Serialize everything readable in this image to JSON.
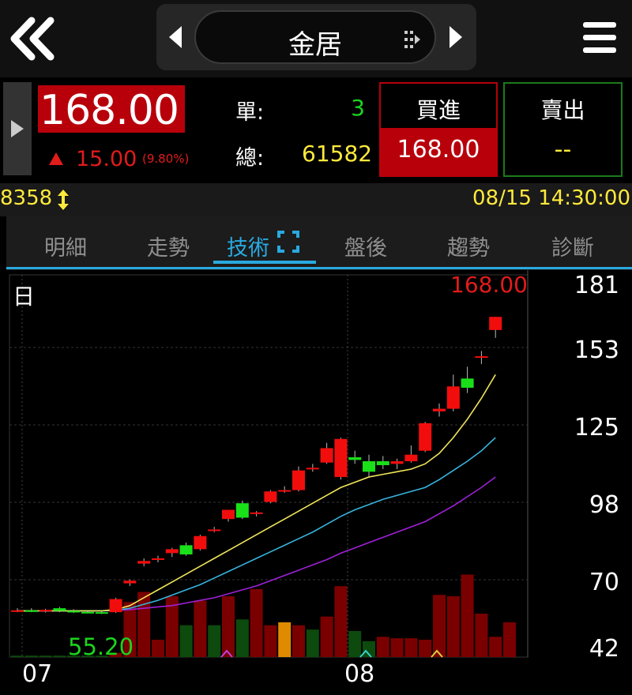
{
  "header": {
    "title": "金居",
    "icons": [
      "double-chevron-left-icon",
      "triangle-left-icon",
      "triangle-right-icon",
      "drag-handle-icon",
      "hamburger-menu-icon"
    ]
  },
  "quote": {
    "price": "168.00",
    "change": "15.00",
    "change_pct": "(9.80%)",
    "single_label": "單:",
    "single_value": "3",
    "total_label": "總:",
    "total_value": "61582",
    "buy_label": "買進",
    "buy_price": "168.00",
    "sell_label": "賣出",
    "sell_price": "--",
    "colors": {
      "up": "#e21b1b",
      "down": "#1cd51c",
      "accent": "#29a9e0",
      "highlight": "#ffea3c"
    }
  },
  "info": {
    "volume": "8358",
    "datetime": "08/15 14:30:00"
  },
  "tabs": [
    {
      "label": "明細",
      "active": false
    },
    {
      "label": "走勢",
      "active": false
    },
    {
      "label": "技術",
      "active": true
    },
    {
      "label": "盤後",
      "active": false
    },
    {
      "label": "趨勢",
      "active": false
    },
    {
      "label": "診斷",
      "active": false
    }
  ],
  "chart": {
    "period_label": "日",
    "last_price": "168.00",
    "min_label": "55.20",
    "y_ticks": [
      "181",
      "153",
      "125",
      "98",
      "70",
      "42"
    ],
    "x_ticks": [
      "07",
      "08"
    ]
  },
  "chart_data": {
    "type": "candlestick",
    "ylim": [
      42,
      181
    ],
    "x_ticks": [
      "07",
      "08"
    ],
    "candles": [
      {
        "o": 56.0,
        "h": 57.0,
        "l": 55.5,
        "c": 56.2
      },
      {
        "o": 56.2,
        "h": 57.0,
        "l": 55.5,
        "c": 56.0
      },
      {
        "o": 56.0,
        "h": 56.8,
        "l": 55.4,
        "c": 56.4
      },
      {
        "o": 57.0,
        "h": 57.5,
        "l": 55.5,
        "c": 56.0
      },
      {
        "o": 56.0,
        "h": 56.6,
        "l": 55.2,
        "c": 55.6
      },
      {
        "o": 55.6,
        "h": 56.0,
        "l": 55.2,
        "c": 55.5
      },
      {
        "o": 55.5,
        "h": 56.0,
        "l": 54.8,
        "c": 55.2
      },
      {
        "o": 55.5,
        "h": 61.0,
        "l": 55.2,
        "c": 60.5
      },
      {
        "o": 66.5,
        "h": 68.0,
        "l": 65.5,
        "c": 67.5
      },
      {
        "o": 74.0,
        "h": 76.0,
        "l": 73.0,
        "c": 75.0
      },
      {
        "o": 76.0,
        "h": 77.0,
        "l": 74.5,
        "c": 76.0
      },
      {
        "o": 78.0,
        "h": 80.0,
        "l": 76.5,
        "c": 79.5
      },
      {
        "o": 81.0,
        "h": 82.0,
        "l": 77.0,
        "c": 77.5
      },
      {
        "o": 79.5,
        "h": 85.0,
        "l": 79.0,
        "c": 84.5
      },
      {
        "o": 87.0,
        "h": 88.0,
        "l": 86.0,
        "c": 87.0
      },
      {
        "o": 91.0,
        "h": 93.0,
        "l": 90.0,
        "c": 94.5
      },
      {
        "o": 97.0,
        "h": 98.0,
        "l": 91.0,
        "c": 91.5
      },
      {
        "o": 93.5,
        "h": 94.0,
        "l": 92.0,
        "c": 93.5
      },
      {
        "o": 97.5,
        "h": 102.0,
        "l": 97.0,
        "c": 101.5
      },
      {
        "o": 102.0,
        "h": 103.5,
        "l": 101.0,
        "c": 102.0
      },
      {
        "o": 102.0,
        "h": 111.0,
        "l": 101.5,
        "c": 109.5
      },
      {
        "o": 110.5,
        "h": 112.0,
        "l": 109.0,
        "c": 110.5
      },
      {
        "o": 112.5,
        "h": 120.0,
        "l": 112.0,
        "c": 118.0
      },
      {
        "o": 107.0,
        "h": 122.0,
        "l": 106.0,
        "c": 121.5
      },
      {
        "o": 114.5,
        "h": 117.0,
        "l": 112.0,
        "c": 113.5
      },
      {
        "o": 113.0,
        "h": 115.5,
        "l": 107.0,
        "c": 109.0
      },
      {
        "o": 113.0,
        "h": 115.0,
        "l": 110.0,
        "c": 111.5
      },
      {
        "o": 112.0,
        "h": 114.0,
        "l": 110.0,
        "c": 113.0
      },
      {
        "o": 113.0,
        "h": 119.0,
        "l": 112.5,
        "c": 115.5
      },
      {
        "o": 117.0,
        "h": 128.0,
        "l": 116.5,
        "c": 127.5
      },
      {
        "o": 132.0,
        "h": 135.0,
        "l": 130.0,
        "c": 133.0
      },
      {
        "o": 133.0,
        "h": 146.0,
        "l": 132.0,
        "c": 141.5
      },
      {
        "o": 144.5,
        "h": 149.0,
        "l": 139.0,
        "c": 141.0
      },
      {
        "o": 153.0,
        "h": 155.0,
        "l": 150.0,
        "c": 153.0
      },
      {
        "o": 163.0,
        "h": 168.0,
        "l": 160.0,
        "c": 168.0
      }
    ],
    "ma_short": [
      56,
      56,
      56,
      56,
      56,
      56,
      56,
      56.5,
      58,
      61,
      64,
      67,
      70,
      73,
      76,
      79,
      82,
      85,
      88,
      91,
      94,
      97,
      100,
      103,
      105,
      107,
      108,
      109,
      110,
      112,
      116,
      122,
      129,
      137,
      146
    ],
    "ma_mid": [
      56,
      56,
      56,
      56,
      56,
      56,
      56,
      56.2,
      57,
      58.5,
      60,
      62,
      64,
      66,
      68.5,
      71,
      73.5,
      76,
      78.5,
      81,
      83.5,
      86,
      89,
      92,
      94.5,
      96.5,
      98.5,
      100,
      101.5,
      103,
      106,
      109.5,
      113,
      117,
      122
    ],
    "ma_long": [
      56,
      56,
      56,
      56,
      56,
      56,
      56,
      56.1,
      56.5,
      57,
      57.5,
      58,
      59,
      60,
      61,
      62.5,
      64,
      65.5,
      67.5,
      69.5,
      71.5,
      73.5,
      75.5,
      78,
      80,
      82,
      84,
      86,
      88,
      90,
      93,
      96,
      99.5,
      103,
      107
    ],
    "volumes": [
      {
        "v": 1,
        "up": false
      },
      {
        "v": 1,
        "up": false
      },
      {
        "v": 1,
        "up": false
      },
      {
        "v": 1,
        "up": false
      },
      {
        "v": 1,
        "up": false
      },
      {
        "v": 1,
        "up": false
      },
      {
        "v": 1,
        "up": false
      },
      {
        "v": 3,
        "up": true
      },
      {
        "v": 38,
        "up": true
      },
      {
        "v": 45,
        "up": true
      },
      {
        "v": 12,
        "up": true
      },
      {
        "v": 42,
        "up": true
      },
      {
        "v": 22,
        "up": false
      },
      {
        "v": 39,
        "up": true
      },
      {
        "v": 22,
        "up": false
      },
      {
        "v": 42,
        "up": true
      },
      {
        "v": 26,
        "up": false
      },
      {
        "v": 47,
        "up": true
      },
      {
        "v": 22,
        "up": true
      },
      {
        "v": 24,
        "up": true
      },
      {
        "v": 22,
        "up": true
      },
      {
        "v": 19,
        "up": false
      },
      {
        "v": 28,
        "up": true
      },
      {
        "v": 49,
        "up": true
      },
      {
        "v": 18,
        "up": false
      },
      {
        "v": 11,
        "up": false
      },
      {
        "v": 14,
        "up": true
      },
      {
        "v": 13,
        "up": true
      },
      {
        "v": 13,
        "up": true
      },
      {
        "v": 12,
        "up": true
      },
      {
        "v": 43,
        "up": true
      },
      {
        "v": 42,
        "up": true
      },
      {
        "v": 57,
        "up": true
      },
      {
        "v": 30,
        "up": true
      },
      {
        "v": 14,
        "up": true
      },
      {
        "v": 24,
        "up": true
      }
    ],
    "volume_max": 60
  }
}
